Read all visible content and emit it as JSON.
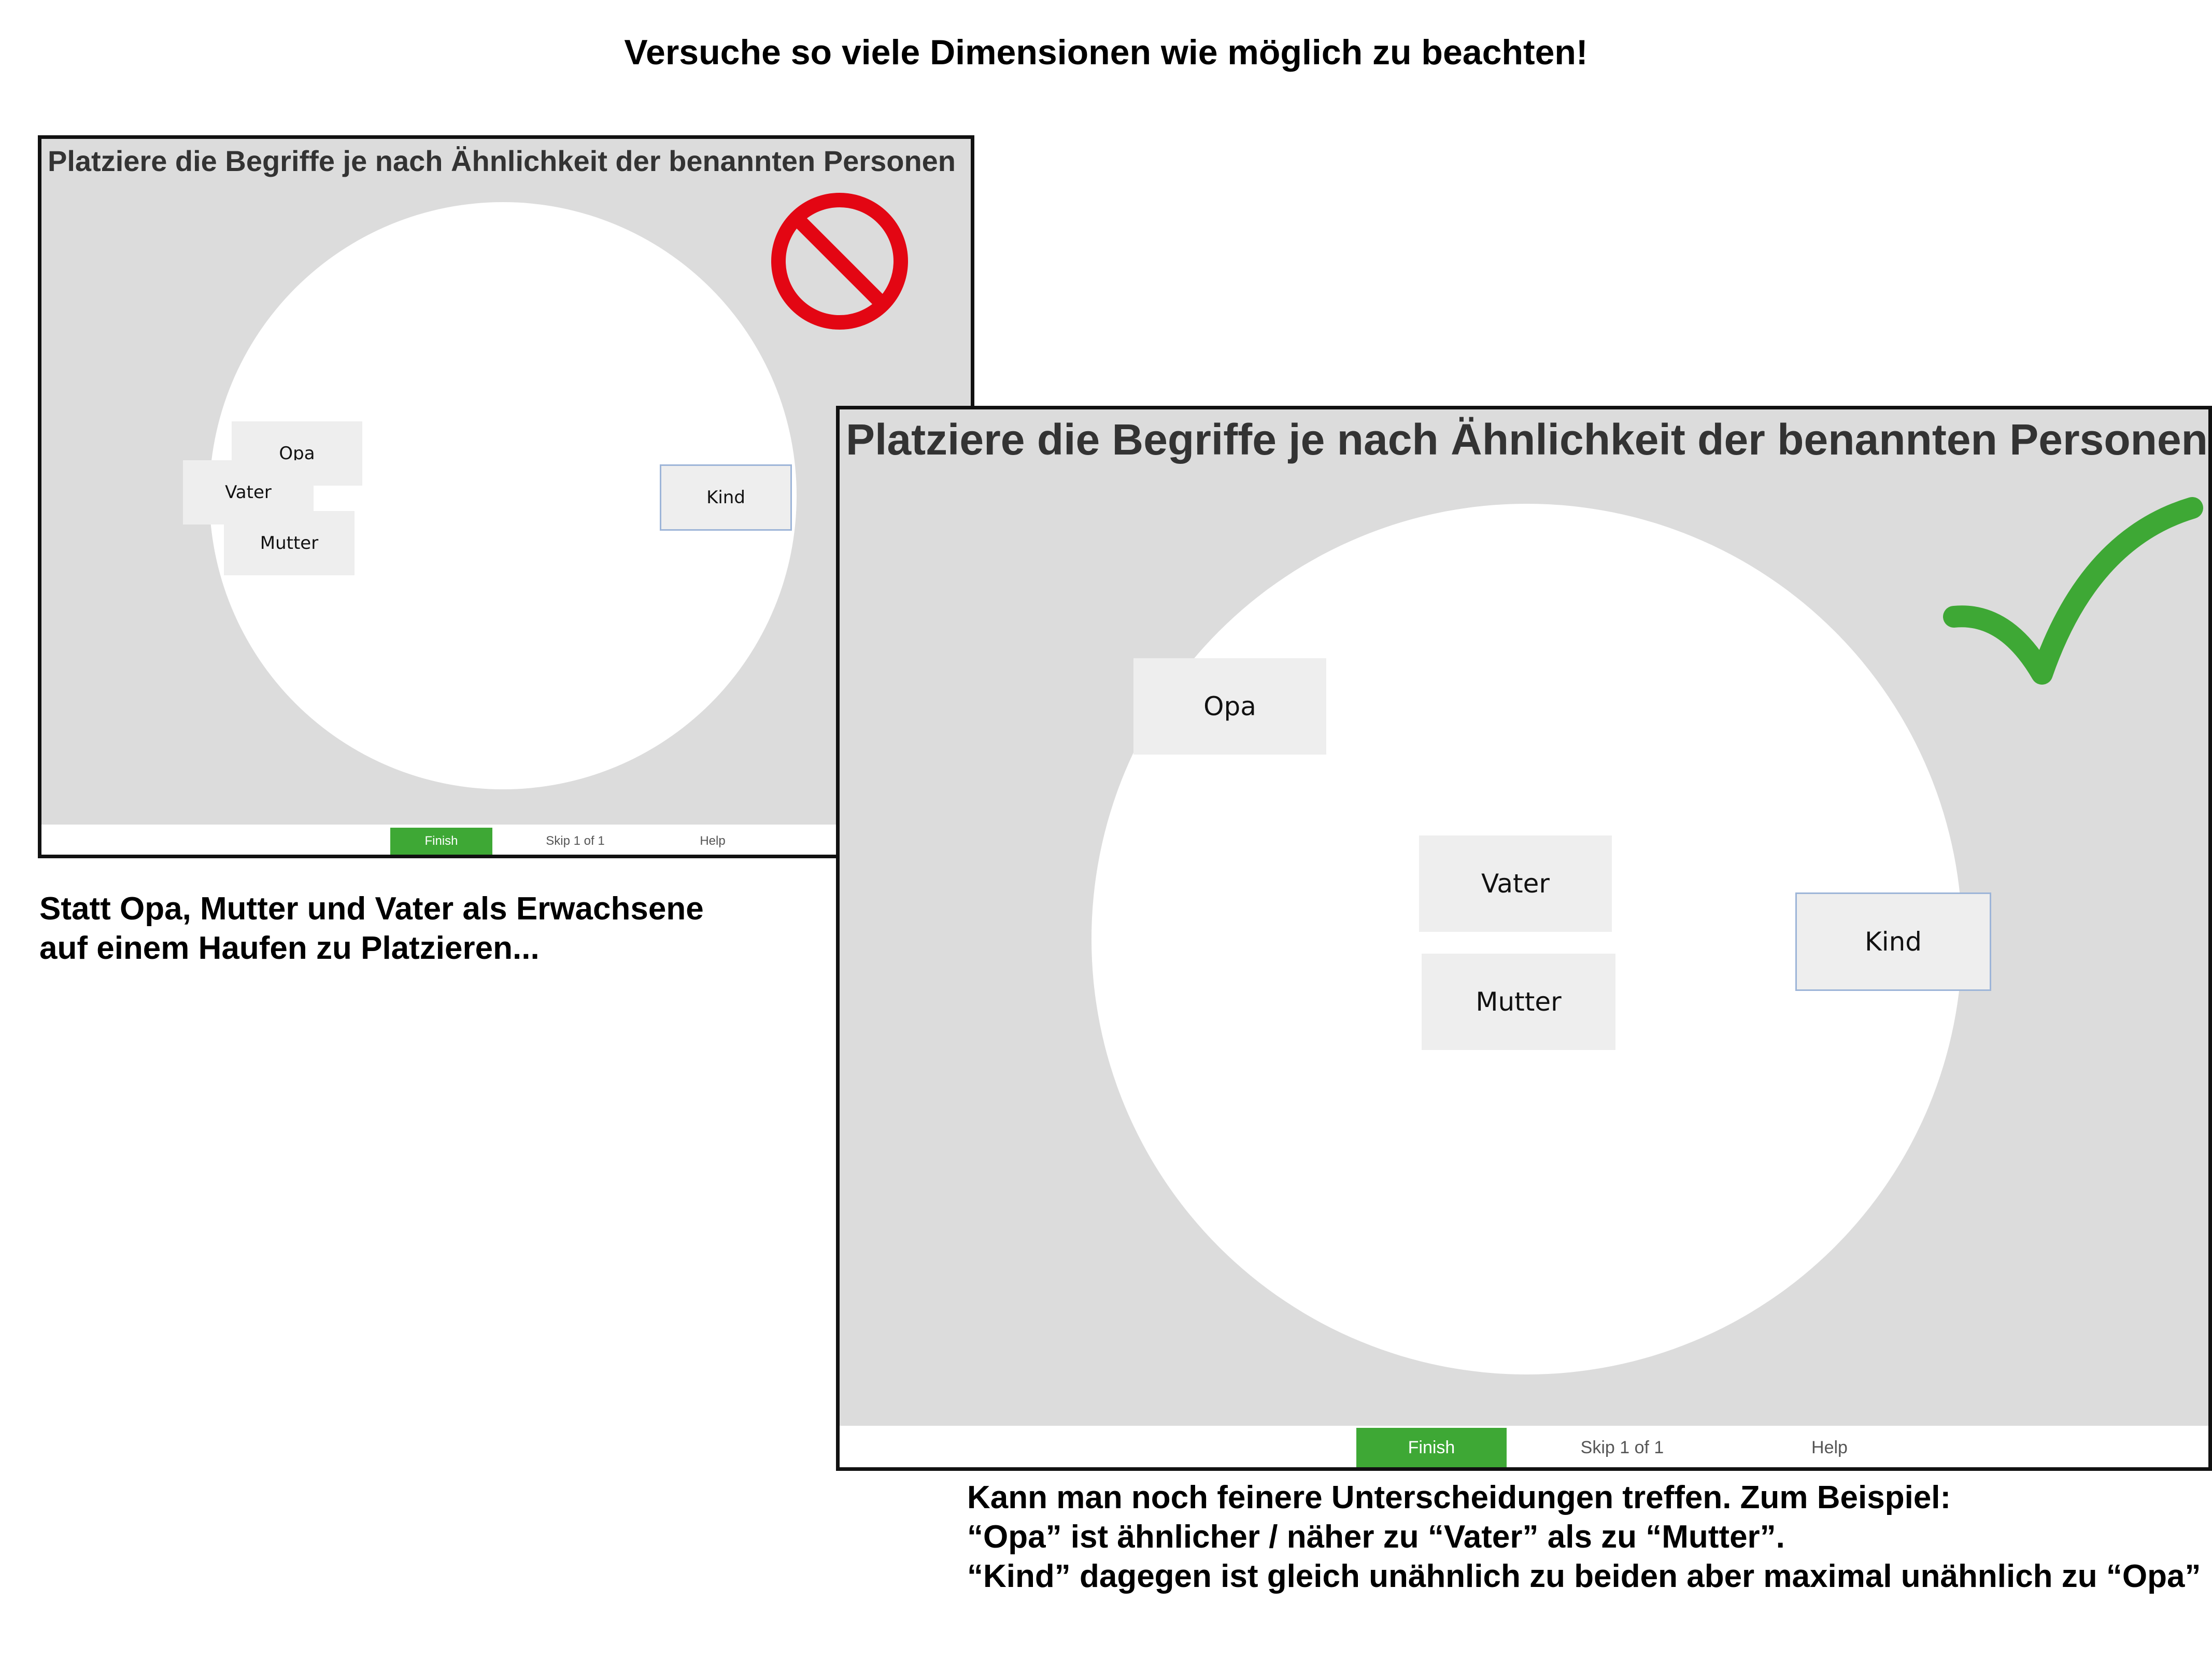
{
  "heading": "Versuche so viele Dimensionen wie möglich zu beachten!",
  "bad_panel": {
    "title": "Platziere die Begriffe je nach Ähnlichkeit der benannten Personen",
    "cards": {
      "opa": "Opa",
      "vater": "Vater",
      "mutter": "Mutter",
      "kind": "Kind"
    },
    "footer": {
      "finish": "Finish",
      "skip": "Skip 1 of 1",
      "help": "Help"
    },
    "status_icon": "prohibited-icon",
    "status_color": "#e30613"
  },
  "good_panel": {
    "title": "Platziere die Begriffe je nach Ähnlichkeit der benannten Personen",
    "cards": {
      "opa": "Opa",
      "vater": "Vater",
      "mutter": "Mutter",
      "kind": "Kind"
    },
    "footer": {
      "finish": "Finish",
      "skip": "Skip 1 of 1",
      "help": "Help"
    },
    "status_icon": "checkmark-icon",
    "status_color": "#3ea835"
  },
  "captions": {
    "bad": [
      "Statt Opa, Mutter und Vater als Erwachsene",
      "auf einem Haufen zu Platzieren..."
    ],
    "good": [
      "Kann man noch feinere Unterscheidungen treffen. Zum Beispiel:",
      "“Opa” ist ähnlicher / näher zu “Vater” als zu “Mutter”.",
      "“Kind” dagegen ist gleich unähnlich zu beiden aber maximal unähnlich zu “Opa”"
    ]
  },
  "colors": {
    "finish_green": "#3ea835",
    "selected_border": "#9db5d8",
    "canvas_gray": "#dcdcdc"
  }
}
